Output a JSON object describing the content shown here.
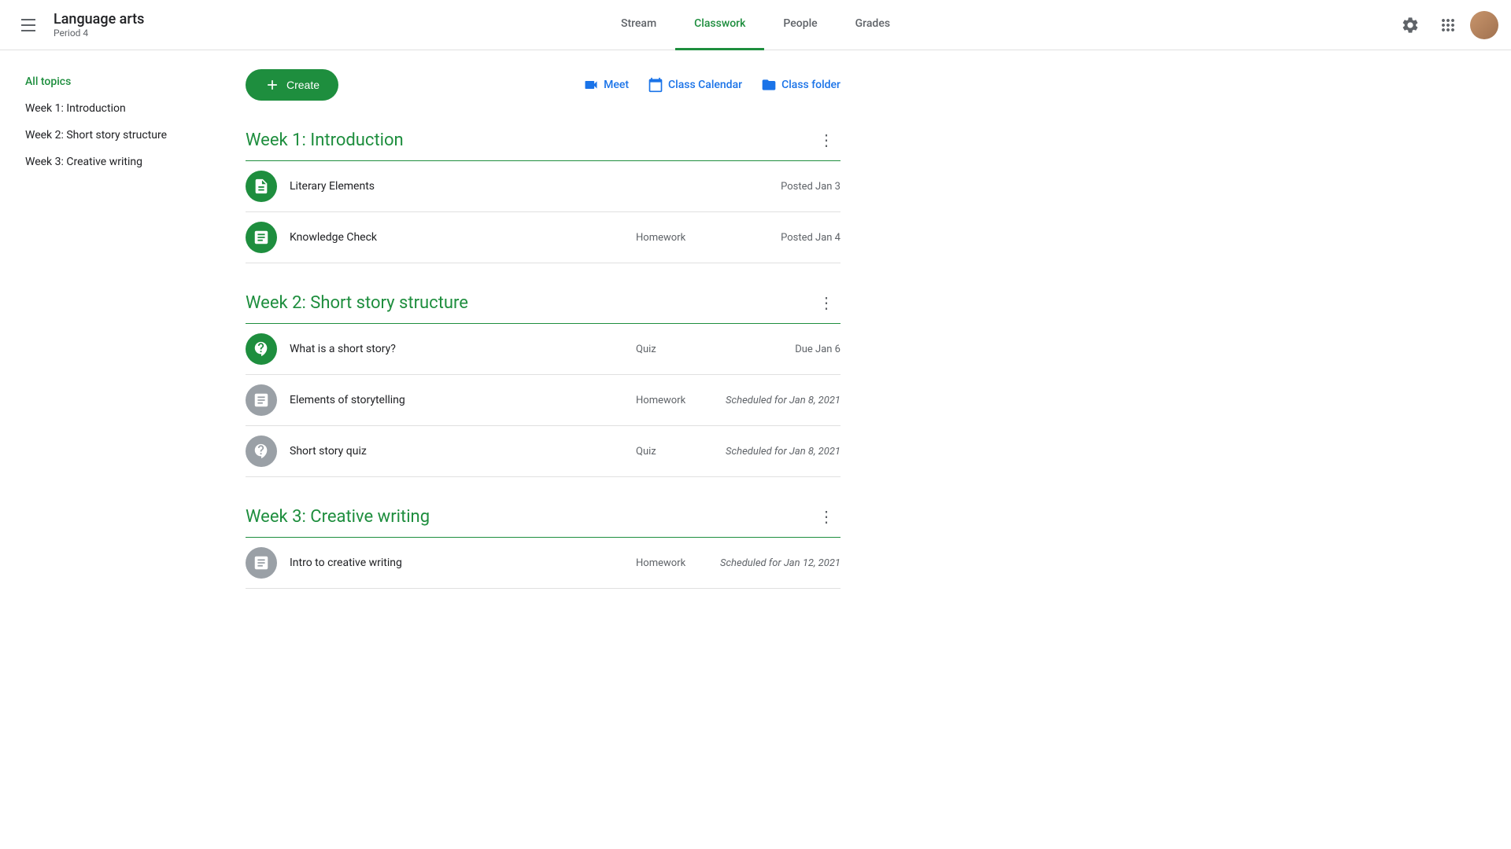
{
  "app": {
    "title": "Language arts",
    "subtitle": "Period 4"
  },
  "nav": {
    "items": [
      {
        "id": "stream",
        "label": "Stream",
        "active": false
      },
      {
        "id": "classwork",
        "label": "Classwork",
        "active": true
      },
      {
        "id": "people",
        "label": "People",
        "active": false
      },
      {
        "id": "grades",
        "label": "Grades",
        "active": false
      }
    ]
  },
  "toolbar": {
    "create_label": "Create",
    "meet_label": "Meet",
    "calendar_label": "Class Calendar",
    "folder_label": "Class folder"
  },
  "sidebar": {
    "items": [
      {
        "id": "all-topics",
        "label": "All topics",
        "active": true
      },
      {
        "id": "week1",
        "label": "Week 1: Introduction",
        "active": false
      },
      {
        "id": "week2",
        "label": "Week 2: Short story structure",
        "active": false
      },
      {
        "id": "week3",
        "label": "Week 3: Creative writing",
        "active": false
      }
    ]
  },
  "weeks": [
    {
      "id": "week1",
      "title": "Week 1: Introduction",
      "assignments": [
        {
          "id": "literary-elements",
          "name": "Literary Elements",
          "type": "",
          "date": "Posted Jan 3",
          "date_scheduled": false,
          "icon_type": "doc",
          "icon_color": "green"
        },
        {
          "id": "knowledge-check",
          "name": "Knowledge Check",
          "type": "Homework",
          "date": "Posted Jan 4",
          "date_scheduled": false,
          "icon_type": "assignment",
          "icon_color": "green"
        }
      ]
    },
    {
      "id": "week2",
      "title": "Week 2: Short story structure",
      "assignments": [
        {
          "id": "what-is-a-short-story",
          "name": "What is a short story?",
          "type": "Quiz",
          "date": "Due Jan 6",
          "date_scheduled": false,
          "icon_type": "quiz",
          "icon_color": "green"
        },
        {
          "id": "elements-of-storytelling",
          "name": "Elements of storytelling",
          "type": "Homework",
          "date": "Scheduled for Jan 8, 2021",
          "date_scheduled": true,
          "icon_type": "assignment",
          "icon_color": "gray"
        },
        {
          "id": "short-story-quiz",
          "name": "Short story quiz",
          "type": "Quiz",
          "date": "Scheduled for Jan 8, 2021",
          "date_scheduled": true,
          "icon_type": "quiz",
          "icon_color": "gray"
        }
      ]
    },
    {
      "id": "week3",
      "title": "Week 3: Creative writing",
      "assignments": [
        {
          "id": "intro-to-creative-writing",
          "name": "Intro to creative writing",
          "type": "Homework",
          "date": "Scheduled for Jan 12, 2021",
          "date_scheduled": true,
          "icon_type": "assignment",
          "icon_color": "gray"
        }
      ]
    }
  ]
}
